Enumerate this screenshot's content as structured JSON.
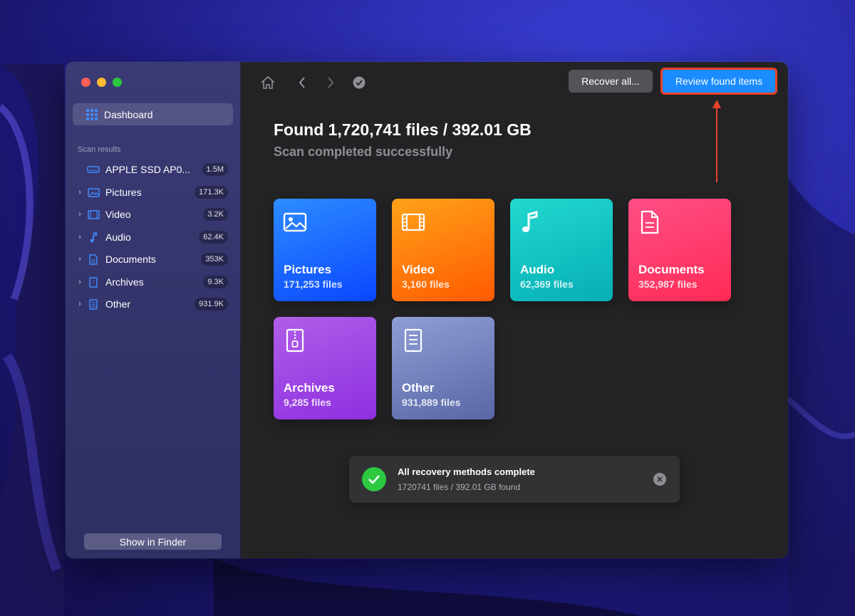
{
  "sidebar": {
    "dashboard_label": "Dashboard",
    "section_label": "Scan results",
    "items": [
      {
        "label": "APPLE SSD AP0...",
        "count": "1.5M",
        "icon": "drive-icon",
        "expandable": false
      },
      {
        "label": "Pictures",
        "count": "171.3K",
        "icon": "pictures-icon",
        "expandable": true
      },
      {
        "label": "Video",
        "count": "3.2K",
        "icon": "video-icon",
        "expandable": true
      },
      {
        "label": "Audio",
        "count": "62.4K",
        "icon": "audio-icon",
        "expandable": true
      },
      {
        "label": "Documents",
        "count": "353K",
        "icon": "documents-icon",
        "expandable": true
      },
      {
        "label": "Archives",
        "count": "9.3K",
        "icon": "archives-icon",
        "expandable": true
      },
      {
        "label": "Other",
        "count": "931.9K",
        "icon": "other-icon",
        "expandable": true
      }
    ],
    "finder_button": "Show in Finder"
  },
  "toolbar": {
    "recover_all": "Recover all...",
    "review_found": "Review found items",
    "highlight_color": "#e8432a"
  },
  "summary": {
    "title": "Found 1,720,741 files / 392.01 GB",
    "subtitle": "Scan completed successfully"
  },
  "cards": [
    {
      "label": "Pictures",
      "count": "171,253 files",
      "icon": "pictures-icon",
      "colors": [
        "#2d8cff",
        "#0a47ff"
      ]
    },
    {
      "label": "Video",
      "count": "3,160 files",
      "icon": "film-icon",
      "colors": [
        "#ffa21a",
        "#ff5a00"
      ]
    },
    {
      "label": "Audio",
      "count": "62,369 files",
      "icon": "music-note-icon",
      "colors": [
        "#23d8cf",
        "#05aeb5"
      ]
    },
    {
      "label": "Documents",
      "count": "352,987 files",
      "icon": "document-icon",
      "colors": [
        "#ff4f86",
        "#ff2a55"
      ]
    },
    {
      "label": "Archives",
      "count": "9,285 files",
      "icon": "zip-archive-icon",
      "colors": [
        "#b05ee8",
        "#8d2fe0"
      ]
    },
    {
      "label": "Other",
      "count": "931,889 files",
      "icon": "file-icon",
      "colors": [
        "#8f9ed6",
        "#5a66a6"
      ]
    }
  ],
  "toast": {
    "title": "All recovery methods complete",
    "subtitle": "1720741 files / 392.01 GB found"
  }
}
